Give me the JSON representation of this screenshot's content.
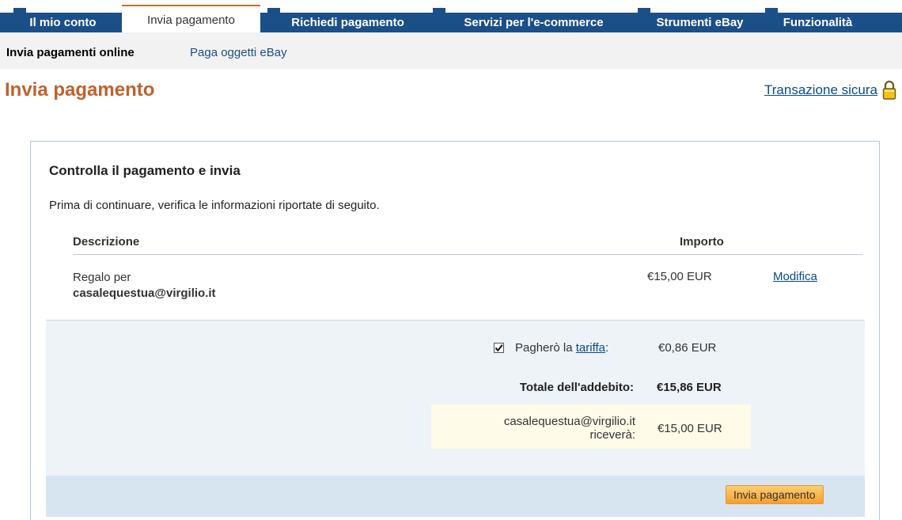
{
  "tabs": [
    {
      "label": "Il mio conto"
    },
    {
      "label": "Invia pagamento"
    },
    {
      "label": "Richiedi pagamento"
    },
    {
      "label": "Servizi per l'e-commerce"
    },
    {
      "label": "Strumenti eBay"
    },
    {
      "label": "Funzionalità"
    }
  ],
  "subnav": [
    {
      "label": "Invia pagamenti online"
    },
    {
      "label": "Paga oggetti eBay"
    }
  ],
  "header": {
    "title": "Invia pagamento",
    "secure_link": "Transazione sicura",
    "secure_icon": "lock-icon"
  },
  "review": {
    "title": "Controlla il pagamento e invia",
    "intro": "Prima di continuare, verifica le informazioni riportate di seguito.",
    "columns": {
      "description": "Descrizione",
      "amount": "Importo"
    },
    "item": {
      "desc_prefix": "Regalo per",
      "email": "casalequestua@virgilio.it",
      "amount": "€15,00 EUR",
      "modify": "Modifica"
    },
    "fee": {
      "checked": true,
      "label_prefix": "Pagherò la",
      "link": "tariffa",
      "suffix": ":",
      "amount": "€0,86 EUR"
    },
    "total": {
      "label": "Totale dell'addebito:",
      "amount": "€15,86 EUR"
    },
    "receive": {
      "email": "casalequestua@virgilio.it",
      "verb": "riceverà:",
      "amount": "€15,00 EUR"
    },
    "button": "Invia pagamento"
  },
  "colors": {
    "nav_blue": "#1b4f88",
    "title_orange": "#c0612b",
    "button_orange": "#f4a02f",
    "link_blue": "#084b8a"
  }
}
